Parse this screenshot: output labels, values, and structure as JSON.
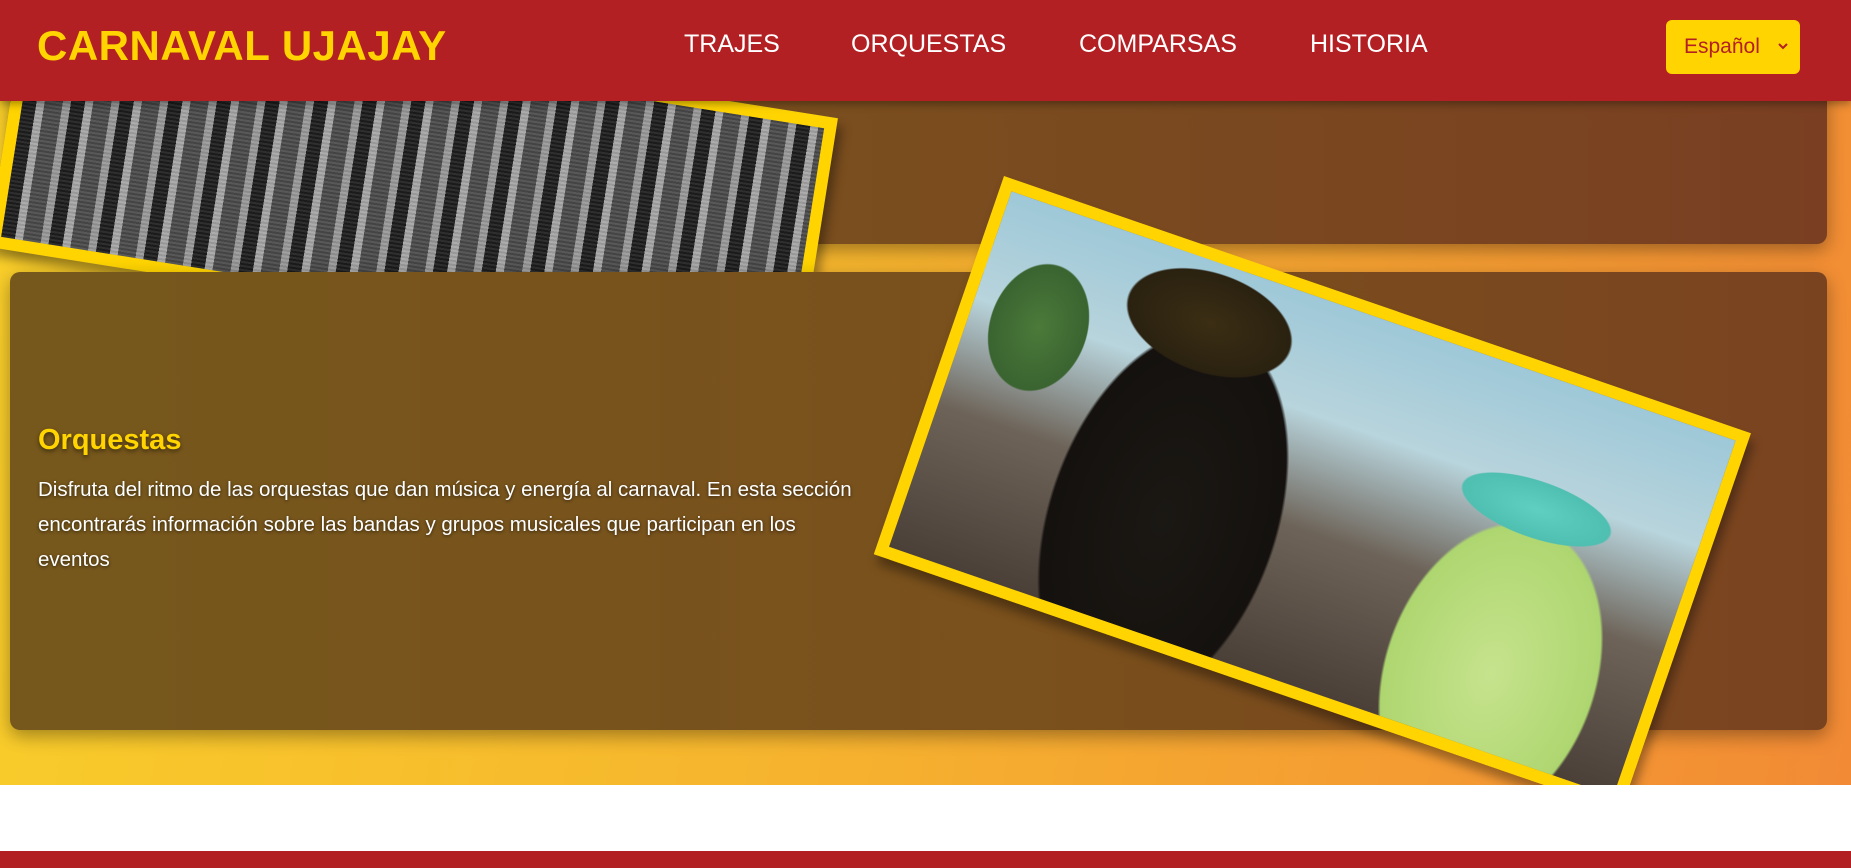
{
  "header": {
    "brand": "CARNAVAL UJAJAY",
    "nav": [
      "TRAJES",
      "ORQUESTAS",
      "COMPARSAS",
      "HISTORIA"
    ],
    "language_selected": "Español"
  },
  "sections": {
    "orquestas": {
      "title": "Orquestas",
      "text": "Disfruta del ritmo de las orquestas que dan música y energía al carnaval. En esta sección encontrarás información sobre las bandas y grupos musicales que participan en los eventos"
    }
  },
  "colors": {
    "header_bg": "#b32024",
    "accent_yellow": "#ffd400",
    "card_bg": "#7a5a1b"
  }
}
